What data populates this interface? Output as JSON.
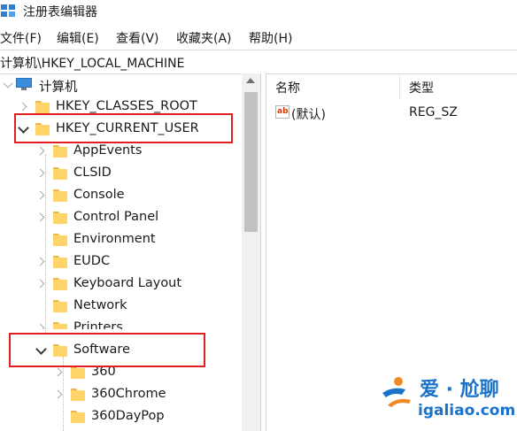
{
  "window": {
    "title": "注册表编辑器"
  },
  "menu": [
    {
      "label": "文件(F)"
    },
    {
      "label": "编辑(E)"
    },
    {
      "label": "查看(V)"
    },
    {
      "label": "收藏夹(A)"
    },
    {
      "label": "帮助(H)"
    }
  ],
  "address": {
    "path": "计算机\\HKEY_LOCAL_MACHINE"
  },
  "tree": {
    "root": {
      "label": "计算机"
    },
    "nodes": [
      {
        "label": "HKEY_CLASSES_ROOT"
      },
      {
        "label": "HKEY_CURRENT_USER"
      },
      {
        "label": "AppEvents"
      },
      {
        "label": "CLSID"
      },
      {
        "label": "Console"
      },
      {
        "label": "Control Panel"
      },
      {
        "label": "Environment"
      },
      {
        "label": "EUDC"
      },
      {
        "label": "Keyboard Layout"
      },
      {
        "label": "Network"
      },
      {
        "label": "Printers"
      },
      {
        "label": "Software"
      },
      {
        "label": "360"
      },
      {
        "label": "360Chrome"
      },
      {
        "label": "360DayPop"
      }
    ]
  },
  "list": {
    "columns": [
      {
        "label": "名称"
      },
      {
        "label": "类型"
      }
    ],
    "rows": [
      {
        "name": "(默认)",
        "type": "REG_SZ",
        "icon": "ab-string-icon"
      }
    ]
  },
  "watermark": {
    "brand": "爱 · 尬聊",
    "url": "igaliao.com"
  },
  "colors": {
    "highlight": "#e02020",
    "folder": "#ffd56a",
    "brand": "#1a73c8"
  }
}
